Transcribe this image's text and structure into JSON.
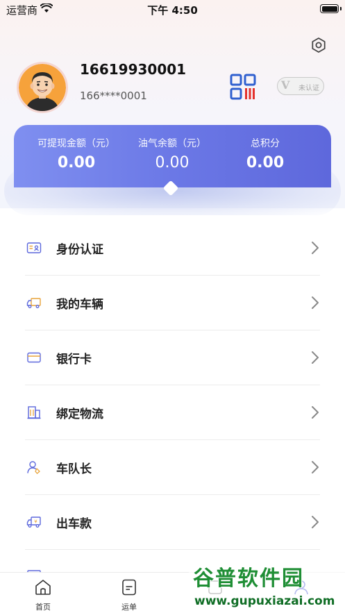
{
  "status_bar": {
    "carrier": "运营商",
    "time": "下午 4:50"
  },
  "profile": {
    "phone": "16619930001",
    "masked_phone": "166****0001",
    "verify_badge": "未认证",
    "verify_letter": "V"
  },
  "balances": [
    {
      "label": "可提现金额（元）",
      "value": "0.00"
    },
    {
      "label": "油气余额（元）",
      "value": "0.00"
    },
    {
      "label": "总积分",
      "value": "0.00"
    }
  ],
  "menu": [
    {
      "label": "身份认证",
      "icon": "id-card-icon"
    },
    {
      "label": "我的车辆",
      "icon": "truck-icon"
    },
    {
      "label": "银行卡",
      "icon": "bank-card-icon"
    },
    {
      "label": "绑定物流",
      "icon": "building-icon"
    },
    {
      "label": "车队长",
      "icon": "captain-icon"
    },
    {
      "label": "出车款",
      "icon": "payment-truck-icon"
    }
  ],
  "tabs": [
    {
      "label": "首页",
      "icon": "home-icon"
    },
    {
      "label": "运单",
      "icon": "waybill-icon"
    },
    {
      "label": "",
      "icon": "scan-icon"
    },
    {
      "label": "",
      "icon": "profile-icon"
    }
  ],
  "watermark": {
    "logo": "谷普软件园",
    "url": "www.gupuxiazai.com"
  },
  "colors": {
    "accent": "#5e68dc",
    "card_start": "#7f8ff0",
    "card_end": "#5e68dc",
    "watermark": "#1f8e35"
  }
}
